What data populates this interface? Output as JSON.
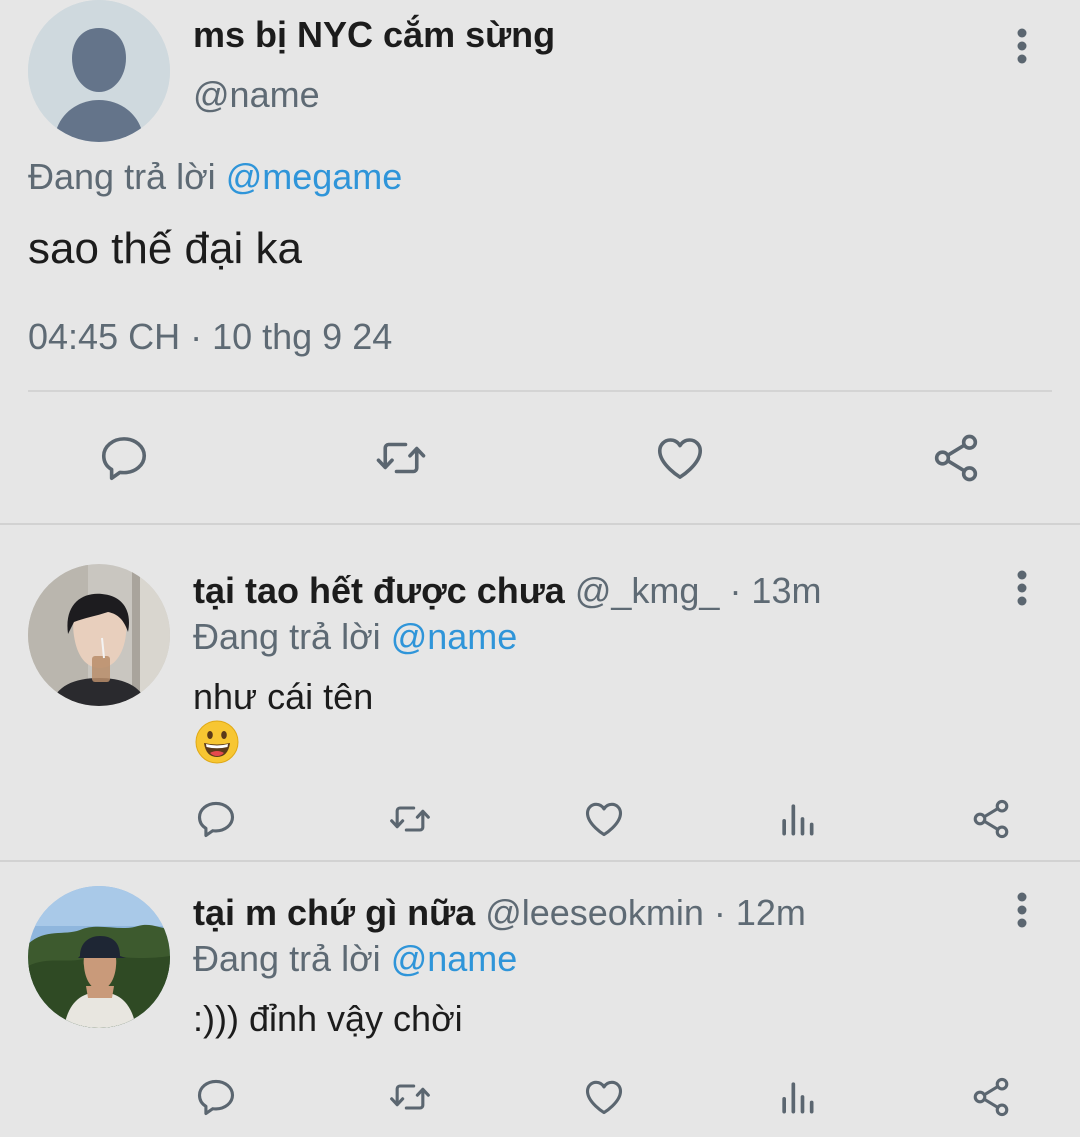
{
  "main_tweet": {
    "author_name": "ms bị NYC cắm sừng",
    "author_handle": "@name",
    "reply_prefix": "Đang trả lời ",
    "reply_mention": "@megame",
    "text": "sao thế đại ka",
    "timestamp": "04:45 CH · 10 thg 9 24",
    "actions": [
      "reply-icon",
      "retweet-icon",
      "heart-icon",
      "share-icon"
    ]
  },
  "replies": [
    {
      "author_name": "tại tao hết được chưa",
      "handle": "@_kmg_",
      "time": "· 13m",
      "reply_prefix": "Đang trả lời ",
      "reply_mention": "@name",
      "text": "như cái tên",
      "emoji": "grinning-face",
      "actions": [
        "reply-icon",
        "retweet-icon",
        "heart-icon",
        "views-icon",
        "share-icon"
      ]
    },
    {
      "author_name": "tại m chứ gì nữa",
      "handle": "@leeseokmin",
      "time": "· 12m",
      "reply_prefix": "Đang trả lời ",
      "reply_mention": "@name",
      "text": ":))) đỉnh vậy chời",
      "actions": [
        "reply-icon",
        "retweet-icon",
        "heart-icon",
        "views-icon",
        "share-icon"
      ]
    }
  ],
  "colors": {
    "background": "#e6e6e6",
    "mention": "#2f95d9",
    "secondary_text": "#5e6a74",
    "icon": "#5b6670"
  }
}
